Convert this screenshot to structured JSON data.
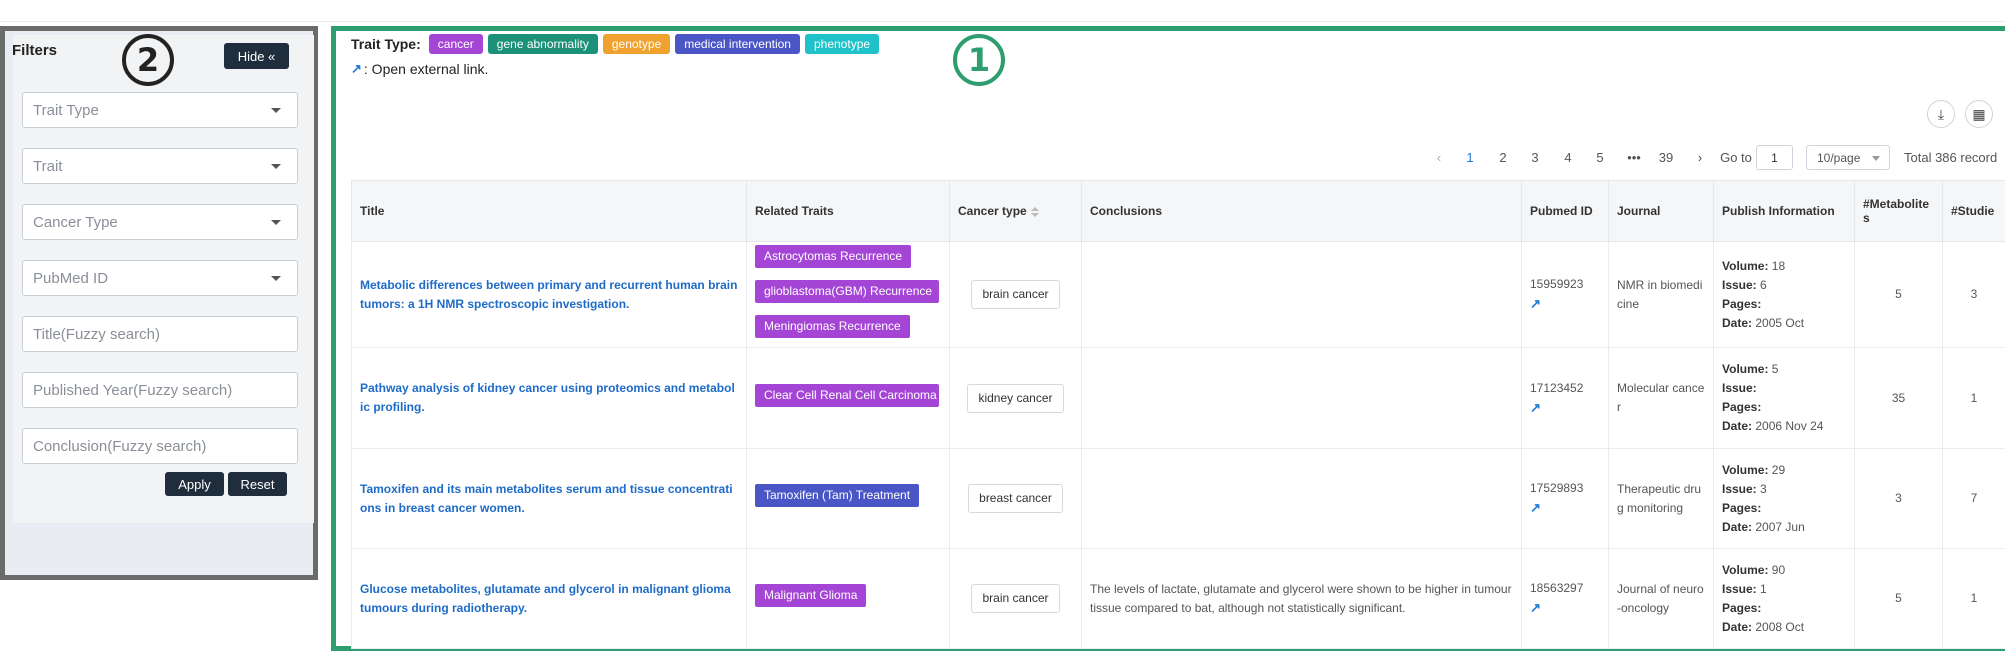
{
  "filters": {
    "title": "Filters",
    "hide_label": "Hide «",
    "fields": [
      {
        "placeholder": "Trait Type",
        "type": "select"
      },
      {
        "placeholder": "Trait",
        "type": "select"
      },
      {
        "placeholder": "Cancer Type",
        "type": "select"
      },
      {
        "placeholder": "PubMed ID",
        "type": "select"
      },
      {
        "placeholder": "Title(Fuzzy search)",
        "type": "text"
      },
      {
        "placeholder": "Published Year(Fuzzy search)",
        "type": "text"
      },
      {
        "placeholder": "Conclusion(Fuzzy search)",
        "type": "text"
      }
    ],
    "apply_label": "Apply",
    "reset_label": "Reset"
  },
  "annotations": {
    "main_number": "1",
    "filters_number": "2"
  },
  "trait_type": {
    "label": "Trait Type:",
    "tags": [
      {
        "label": "cancer",
        "color": "#a445d6"
      },
      {
        "label": "gene abnormality",
        "color": "#1a9178"
      },
      {
        "label": "genotype",
        "color": "#f0a22e"
      },
      {
        "label": "medical intervention",
        "color": "#4a55c6"
      },
      {
        "label": "phenotype",
        "color": "#1fc2c9"
      }
    ]
  },
  "legend": {
    "text": ": Open external link."
  },
  "pagination": {
    "pages": [
      "1",
      "2",
      "3",
      "4",
      "5",
      "•••",
      "39"
    ],
    "current": "1",
    "goto_label": "Go to",
    "goto_value": "1",
    "page_size": "10/page",
    "total": "Total 386 record"
  },
  "table": {
    "headers": [
      "Title",
      "Related Traits",
      "Cancer type",
      "Conclusions",
      "Pubmed ID",
      "Journal",
      "Publish Information",
      "#Metabolites",
      "#Studie"
    ],
    "pub_labels": {
      "volume": "Volume:",
      "issue": "Issue:",
      "pages": "Pages:",
      "date": "Date:"
    },
    "rows": [
      {
        "title": "Metabolic differences between primary and recurrent human brain tumors: a 1H NMR spectroscopic investigation.",
        "traits": [
          "Astrocytomas Recurrence",
          "glioblastoma(GBM) Recurrence",
          "Meningiomas Recurrence"
        ],
        "cancer": "brain cancer",
        "conclusion": "",
        "pubmed": "15959923",
        "journal": "NMR in biomedicine",
        "volume": "18",
        "issue": "6",
        "pages": "",
        "date": "2005 Oct",
        "metabolites": "5",
        "studies": "3"
      },
      {
        "title": "Pathway analysis of kidney cancer using proteomics and metabolic profiling.",
        "traits": [
          "Clear Cell Renal Cell Carcinoma (ccRCC)"
        ],
        "cancer": "kidney cancer",
        "conclusion": "",
        "pubmed": "17123452",
        "journal": "Molecular cancer",
        "volume": "5",
        "issue": "",
        "pages": "",
        "date": "2006 Nov 24",
        "metabolites": "35",
        "studies": "1"
      },
      {
        "title": "Tamoxifen and its main metabolites serum and tissue concentrations in breast cancer women.",
        "traits": [
          "Tamoxifen (Tam) Treatment"
        ],
        "cancer": "breast cancer",
        "conclusion": "",
        "pubmed": "17529893",
        "journal": "Therapeutic drug monitoring",
        "volume": "29",
        "issue": "3",
        "pages": "",
        "date": "2007 Jun",
        "metabolites": "3",
        "studies": "7"
      },
      {
        "title": "Glucose metabolites, glutamate and glycerol in malignant glioma tumours during radiotherapy.",
        "traits": [
          "Malignant Glioma"
        ],
        "cancer": "brain cancer",
        "conclusion": "The levels of lactate, glutamate and glycerol were shown to be higher in tumour tissue compared to bat, although not statistically significant.",
        "pubmed": "18563297",
        "journal": "Journal of neuro-oncology",
        "volume": "90",
        "issue": "1",
        "pages": "",
        "date": "2008 Oct",
        "metabolites": "5",
        "studies": "1"
      }
    ]
  },
  "colors": {
    "accent": "#1e7ad8",
    "main_border": "#2e9e70",
    "filters_border": "#6b6b6b",
    "button": "#1f2d3d"
  }
}
